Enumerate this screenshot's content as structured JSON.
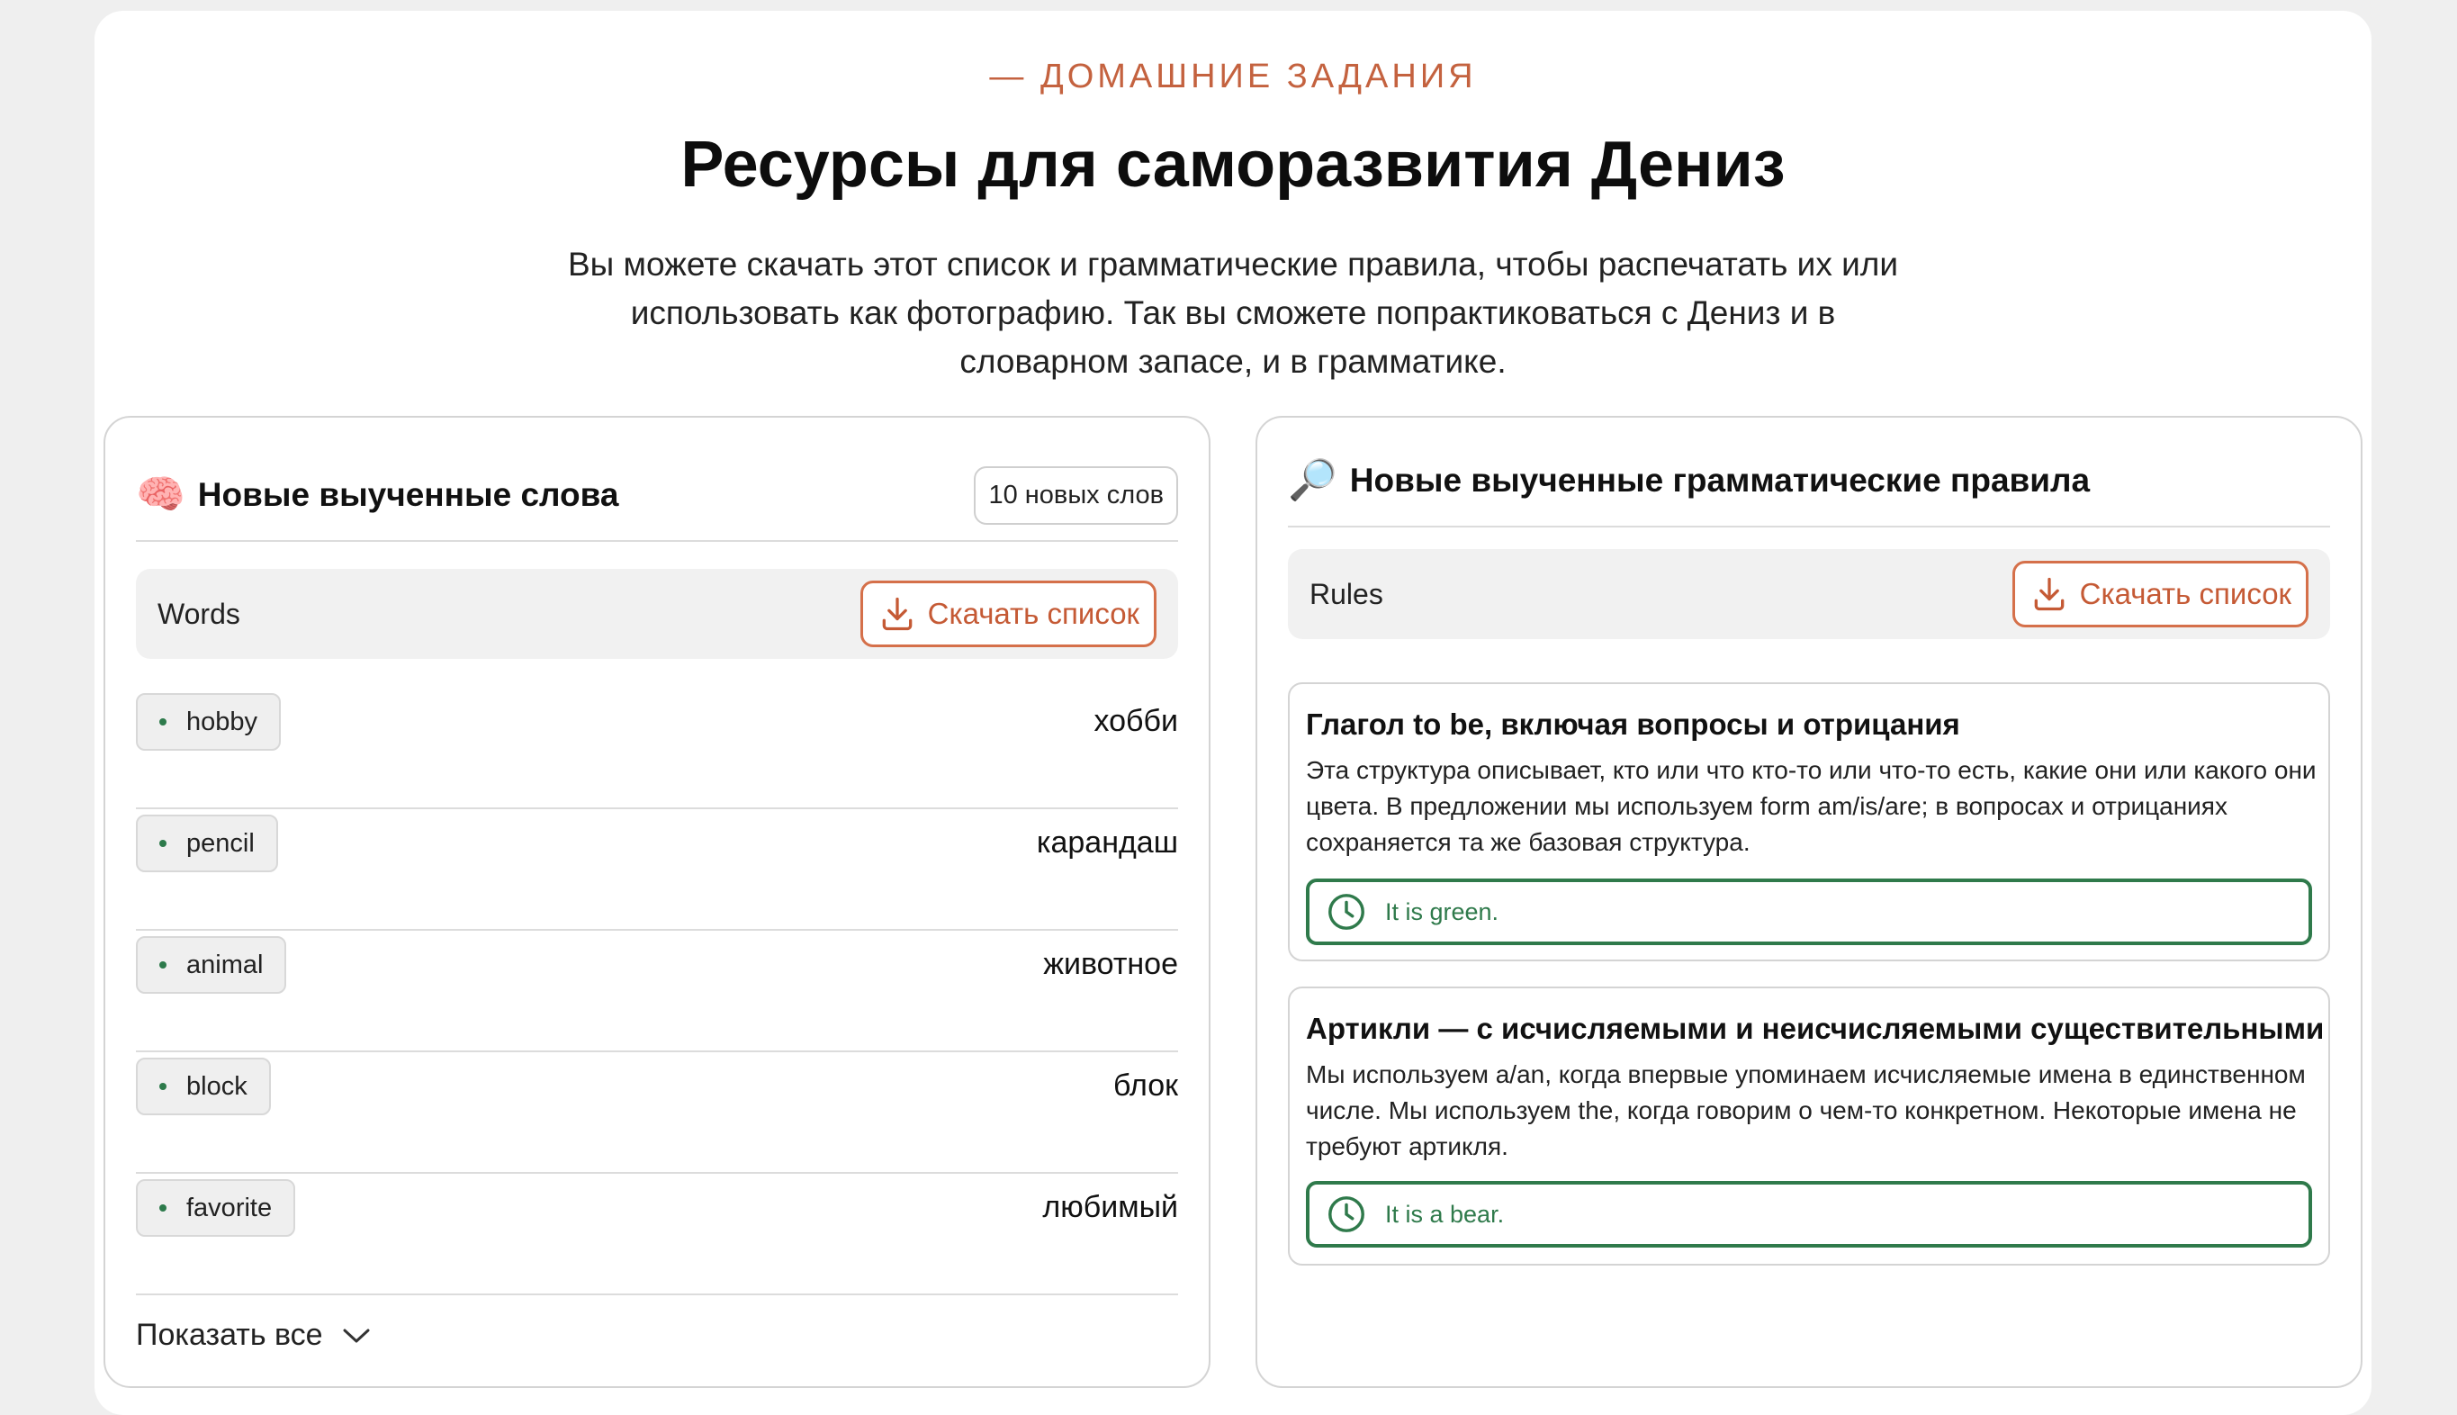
{
  "header": {
    "eyebrow": "— ДОМАШНИЕ ЗАДАНИЯ",
    "title": "Ресурсы для саморазвития Дениз",
    "subtitle": "Вы можете скачать этот список и грамматические правила, чтобы распечатать их или использовать как фотографию. Так вы сможете попрактиковаться с Дениз и в словарном запасе, и в грамматике."
  },
  "words_panel": {
    "icon": "brain-icon",
    "icon_glyph": "🧠",
    "heading": "Новые выученные слова",
    "count_badge": "10 новых слов",
    "list_label": "Words",
    "download_label": "Скачать список",
    "words": [
      {
        "word": "hobby",
        "translation": "хобби"
      },
      {
        "word": "pencil",
        "translation": "карандаш"
      },
      {
        "word": "animal",
        "translation": "животное"
      },
      {
        "word": "block",
        "translation": "блок"
      },
      {
        "word": "favorite",
        "translation": "любимый"
      }
    ],
    "show_all": "Показать все"
  },
  "rules_panel": {
    "icon": "magnifier-icon",
    "icon_glyph": "🔎",
    "heading": "Новые выученные грамматические правила",
    "list_label": "Rules",
    "download_label": "Скачать список",
    "rules": [
      {
        "title": "Глагол to be, включая вопросы и отрицания",
        "description": "Эта структура описывает, кто или что кто-то или что-то есть, какие они или какого они цвета. В предложении мы используем form am/is/are; в вопросах и отрицаниях сохраняется та же базовая структура.",
        "example": "It is green."
      },
      {
        "title": "Артикли — с исчисляемыми и неисчисляемыми существительными",
        "description": "Мы используем a/an, когда впервые упоминаем исчисляемые имена в единственном числе. Мы используем the, когда говорим о чем-то конкретном. Некоторые имена не требуют артикля.",
        "example": "It is a bear."
      }
    ]
  },
  "colors": {
    "accent": "#c4623f",
    "example_green": "#2f7a4b",
    "background": "#efefef"
  }
}
